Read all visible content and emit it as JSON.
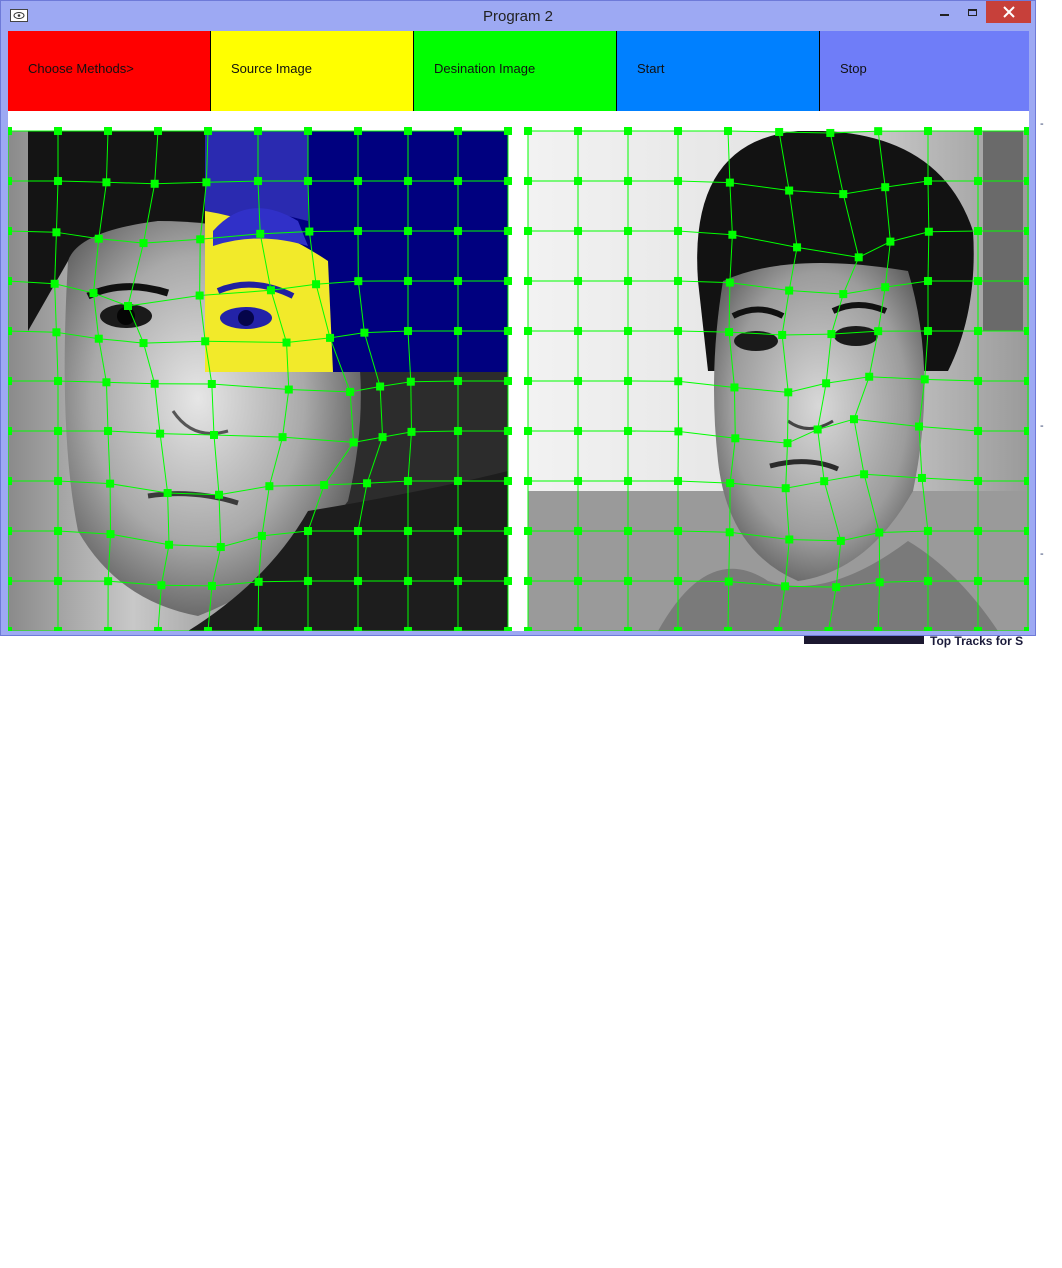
{
  "window": {
    "title": "Program 2"
  },
  "toolbar": {
    "choose_methods": "Choose Methods>",
    "source_image": "Source Image",
    "destination_image": "Desination Image",
    "start": "Start",
    "stop": "Stop"
  },
  "background_page": {
    "snippet_text": "Top Tracks for S"
  },
  "colors": {
    "title_bar": "#9da9f3",
    "close_button": "#c7403a",
    "choose_methods_button": "#ff0000",
    "source_image_button": "#ffff00",
    "destination_image_button": "#00ff00",
    "start_button": "#0080ff",
    "stop_button": "#6f7df8",
    "grid_lines": "#00ff00",
    "selection_highlight_dark": "#00007f",
    "selection_highlight_light": "#f2ea2a"
  },
  "canvas": {
    "source_panel": "photo-portrait-left",
    "destination_panel": "photo-portrait-right",
    "grid_marker_shape": "square",
    "source_grid": "warped",
    "destination_grid": "warped"
  }
}
